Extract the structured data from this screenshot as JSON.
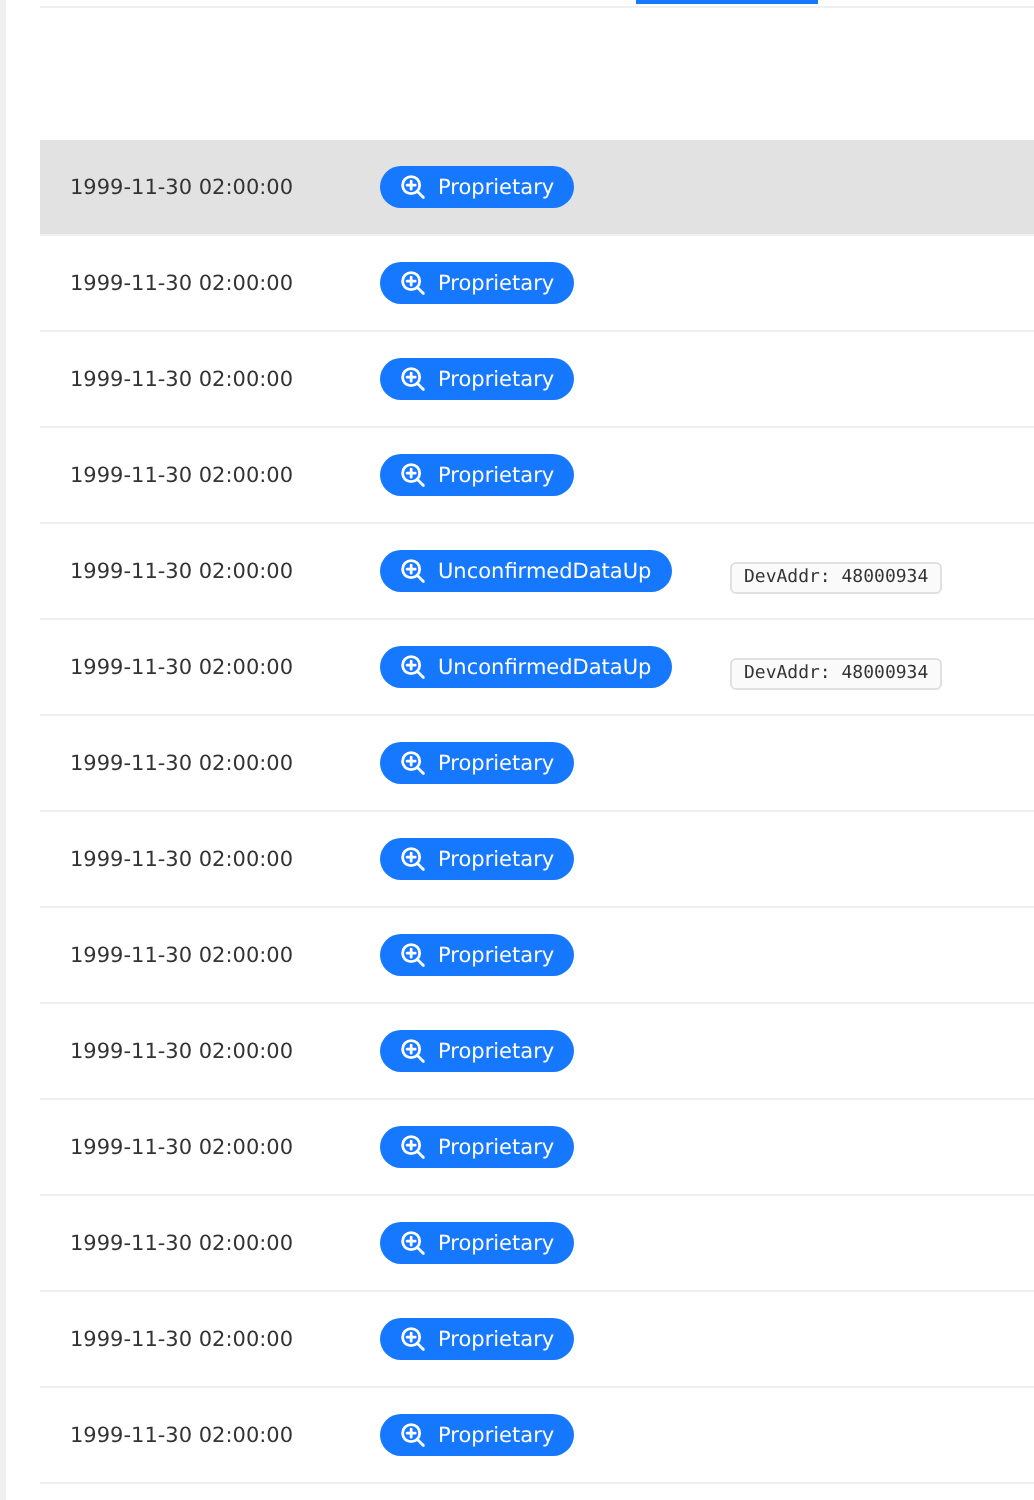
{
  "frames": [
    {
      "time": "1999-11-30 02:00:00",
      "type": "Proprietary",
      "selected": true
    },
    {
      "time": "1999-11-30 02:00:00",
      "type": "Proprietary",
      "selected": false
    },
    {
      "time": "1999-11-30 02:00:00",
      "type": "Proprietary",
      "selected": false
    },
    {
      "time": "1999-11-30 02:00:00",
      "type": "Proprietary",
      "selected": false
    },
    {
      "time": "1999-11-30 02:00:00",
      "type": "UnconfirmedDataUp",
      "selected": false,
      "dev_addr": "DevAddr: 48000934"
    },
    {
      "time": "1999-11-30 02:00:00",
      "type": "UnconfirmedDataUp",
      "selected": false,
      "dev_addr": "DevAddr: 48000934"
    },
    {
      "time": "1999-11-30 02:00:00",
      "type": "Proprietary",
      "selected": false
    },
    {
      "time": "1999-11-30 02:00:00",
      "type": "Proprietary",
      "selected": false
    },
    {
      "time": "1999-11-30 02:00:00",
      "type": "Proprietary",
      "selected": false
    },
    {
      "time": "1999-11-30 02:00:00",
      "type": "Proprietary",
      "selected": false
    },
    {
      "time": "1999-11-30 02:00:00",
      "type": "Proprietary",
      "selected": false
    },
    {
      "time": "1999-11-30 02:00:00",
      "type": "Proprietary",
      "selected": false
    },
    {
      "time": "1999-11-30 02:00:00",
      "type": "Proprietary",
      "selected": false
    },
    {
      "time": "1999-11-30 02:00:00",
      "type": "Proprietary",
      "selected": false
    }
  ]
}
